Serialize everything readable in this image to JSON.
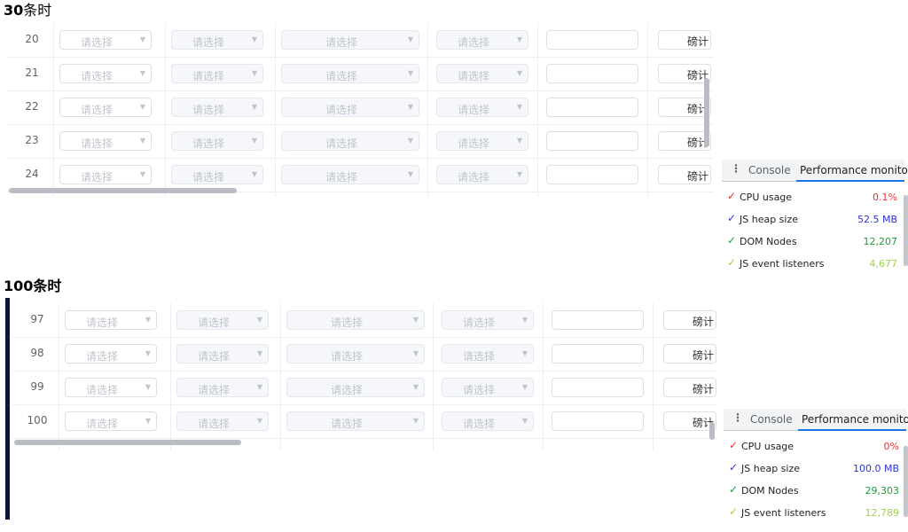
{
  "section1": {
    "heading_bold": "30",
    "heading_rest": "条时",
    "rows": [
      {
        "index": "20",
        "select1": "请选择",
        "select2": "请选择",
        "select3": "请选择",
        "select4": "请选择",
        "button": "磅计"
      },
      {
        "index": "21",
        "select1": "请选择",
        "select2": "请选择",
        "select3": "请选择",
        "select4": "请选择",
        "button": "磅计"
      },
      {
        "index": "22",
        "select1": "请选择",
        "select2": "请选择",
        "select3": "请选择",
        "select4": "请选择",
        "button": "磅计"
      },
      {
        "index": "23",
        "select1": "请选择",
        "select2": "请选择",
        "select3": "请选择",
        "select4": "请选择",
        "button": "磅计"
      },
      {
        "index": "24",
        "select1": "请选择",
        "select2": "请选择",
        "select3": "请选择",
        "select4": "请选择",
        "button": "磅计"
      }
    ],
    "devtools": {
      "tab_console": "Console",
      "tab_perf": "Performance monitor",
      "metrics": [
        {
          "label": "CPU usage",
          "value": "0.1%",
          "color": "#e8333a"
        },
        {
          "label": "JS heap size",
          "value": "52.5 MB",
          "color": "#2d34d8"
        },
        {
          "label": "DOM Nodes",
          "value": "12,207",
          "color": "#1e9e3a"
        },
        {
          "label": "JS event listeners",
          "value": "4,677",
          "color": "#9bd34a"
        }
      ]
    }
  },
  "section2": {
    "heading_bold": "100条时",
    "rows": [
      {
        "index": "97",
        "select1": "请选择",
        "select2": "请选择",
        "select3": "请选择",
        "select4": "请选择",
        "button": "磅计"
      },
      {
        "index": "98",
        "select1": "请选择",
        "select2": "请选择",
        "select3": "请选择",
        "select4": "请选择",
        "button": "磅计"
      },
      {
        "index": "99",
        "select1": "请选择",
        "select2": "请选择",
        "select3": "请选择",
        "select4": "请选择",
        "button": "磅计"
      },
      {
        "index": "100",
        "select1": "请选择",
        "select2": "请选择",
        "select3": "请选择",
        "select4": "请选择",
        "button": "磅计"
      }
    ],
    "devtools": {
      "tab_console": "Console",
      "tab_perf": "Performance monitor",
      "metrics": [
        {
          "label": "CPU usage",
          "value": "0%",
          "color": "#e8333a"
        },
        {
          "label": "JS heap size",
          "value": "100.0 MB",
          "color": "#2d34d8"
        },
        {
          "label": "DOM Nodes",
          "value": "29,303",
          "color": "#1e9e3a"
        },
        {
          "label": "JS event listeners",
          "value": "12,789",
          "color": "#9bd34a"
        }
      ]
    }
  },
  "icons": {
    "dropdown": "caret-down-icon",
    "check": "checkmark-icon",
    "menu": "kebab-menu-icon"
  }
}
